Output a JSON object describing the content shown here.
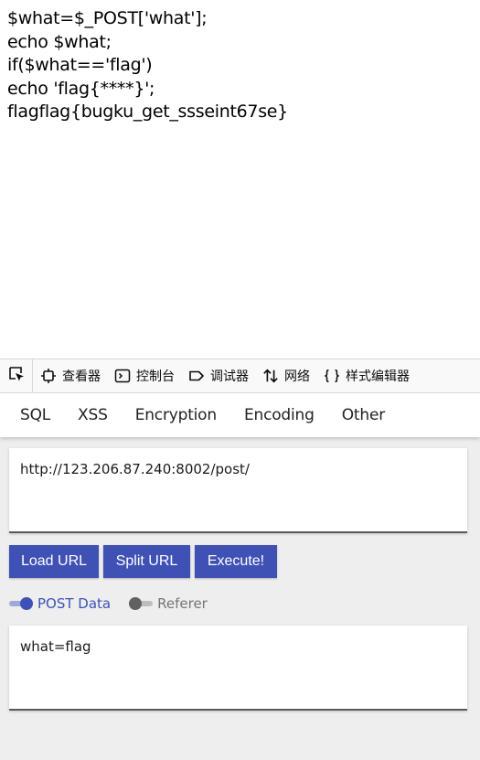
{
  "page_output": {
    "lines": [
      "$what=$_POST['what'];",
      "echo $what;",
      "if($what=='flag')",
      "echo 'flag{****}';",
      "flagflag{bugku_get_ssseint67se}"
    ]
  },
  "devtools": {
    "tabs": [
      {
        "label": "查看器",
        "icon": "inspector-icon"
      },
      {
        "label": "控制台",
        "icon": "console-icon"
      },
      {
        "label": "调试器",
        "icon": "debugger-icon"
      },
      {
        "label": "网络",
        "icon": "network-icon"
      },
      {
        "label": "样式编辑器",
        "icon": "style-editor-icon"
      }
    ]
  },
  "hackbar": {
    "menu": [
      "SQL",
      "XSS",
      "Encryption",
      "Encoding",
      "Other"
    ],
    "url_value": "http://123.206.87.240:8002/post/",
    "buttons": {
      "load": "Load URL",
      "split": "Split URL",
      "execute": "Execute!"
    },
    "toggles": {
      "post": {
        "label": "POST Data",
        "enabled": true
      },
      "referer": {
        "label": "Referer",
        "enabled": false
      }
    },
    "post_value": "what=flag"
  },
  "colors": {
    "accent": "#3f51b5",
    "accent_light": "#9fa8da",
    "panel_bg": "#eeeeee"
  }
}
